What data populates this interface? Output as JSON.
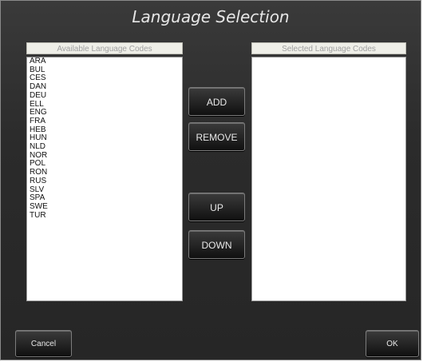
{
  "dialog": {
    "title": "Language Selection"
  },
  "available": {
    "header": "Available Language Codes",
    "items": [
      "ARA",
      "BUL",
      "CES",
      "DAN",
      "DEU",
      "ELL",
      "ENG",
      "FRA",
      "HEB",
      "HUN",
      "NLD",
      "NOR",
      "POL",
      "RON",
      "RUS",
      "SLV",
      "SPA",
      "SWE",
      "TUR"
    ]
  },
  "selected": {
    "header": "Selected Language Codes",
    "items": []
  },
  "buttons": {
    "add": "ADD",
    "remove": "REMOVE",
    "up": "UP",
    "down": "DOWN",
    "cancel": "Cancel",
    "ok": "OK"
  }
}
